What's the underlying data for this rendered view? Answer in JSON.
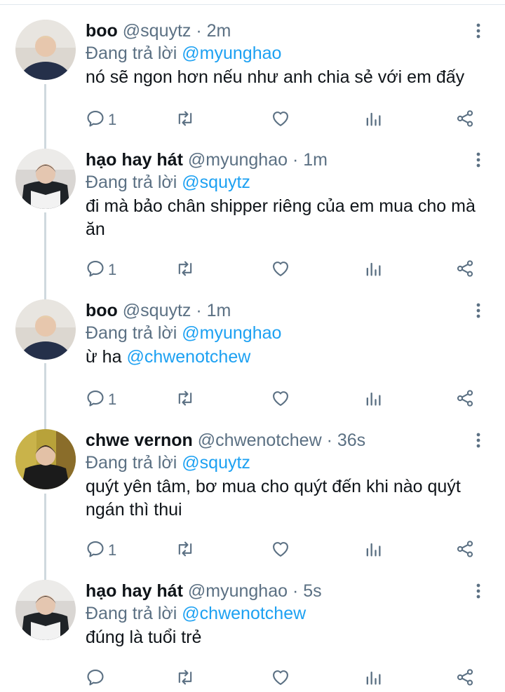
{
  "tweets": [
    {
      "name": "boo",
      "handle": "@squytz",
      "time": "2m",
      "replying_label": "Đang trả lời",
      "replying_to": "@myunghao",
      "text": "nó sẽ ngon hơn nếu như anh chia sẻ với em đấy",
      "mention_in_text": "",
      "reply_count": "1"
    },
    {
      "name": "hạo hay hát",
      "handle": "@myunghao",
      "time": "1m",
      "replying_label": "Đang trả lời",
      "replying_to": "@squytz",
      "text": "đi mà bảo chân shipper riêng của em mua cho mà ăn",
      "mention_in_text": "",
      "reply_count": "1"
    },
    {
      "name": "boo",
      "handle": "@squytz",
      "time": "1m",
      "replying_label": "Đang trả lời",
      "replying_to": "@myunghao",
      "text": "ừ ha ",
      "mention_in_text": "@chwenotchew",
      "reply_count": "1"
    },
    {
      "name": "chwe vernon",
      "handle": "@chwenotchew",
      "time": "36s",
      "replying_label": "Đang trả lời",
      "replying_to": "@squytz",
      "text": "quýt yên tâm, bơ mua cho quýt đến khi nào quýt ngán thì thui",
      "mention_in_text": "",
      "reply_count": "1"
    },
    {
      "name": "hạo hay hát",
      "handle": "@myunghao",
      "time": "5s",
      "replying_label": "Đang trả lời",
      "replying_to": "@chwenotchew",
      "text": "đúng là tuổi trẻ",
      "mention_in_text": "",
      "reply_count": ""
    }
  ],
  "icons": {
    "reply": "reply-icon",
    "retweet": "retweet-icon",
    "like": "heart-icon",
    "analytics": "analytics-icon",
    "share": "share-icon",
    "more": "more-vertical-icon"
  },
  "colors": {
    "accent": "#1da1f2",
    "secondary": "#5b7083",
    "text": "#0f1419",
    "thread": "#cfd9de"
  }
}
